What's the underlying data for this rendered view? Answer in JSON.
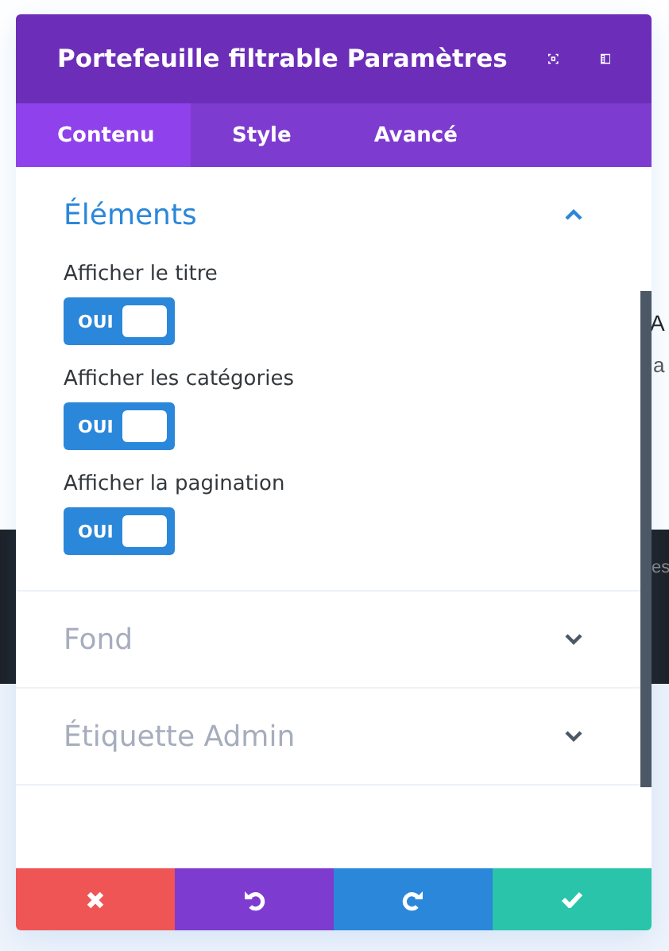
{
  "background": {
    "heading": "A",
    "text": "a",
    "band_text": "es"
  },
  "modal": {
    "title": "Portefeuille filtrable Paramètres",
    "tabs": [
      {
        "label": "Contenu",
        "selected": true
      },
      {
        "label": "Style",
        "selected": false
      },
      {
        "label": "Avancé",
        "selected": false
      }
    ],
    "sections": [
      {
        "title": "Éléments",
        "expanded": true,
        "fields": [
          {
            "label": "Afficher le titre",
            "on": true,
            "value": "OUI"
          },
          {
            "label": "Afficher les catégories",
            "on": true,
            "value": "OUI"
          },
          {
            "label": "Afficher la pagination",
            "on": true,
            "value": "OUI"
          }
        ]
      },
      {
        "title": "Fond",
        "expanded": false
      },
      {
        "title": "Étiquette Admin",
        "expanded": false
      }
    ],
    "footer_buttons": [
      {
        "kind": "cancel"
      },
      {
        "kind": "undo"
      },
      {
        "kind": "redo"
      },
      {
        "kind": "save"
      }
    ]
  }
}
